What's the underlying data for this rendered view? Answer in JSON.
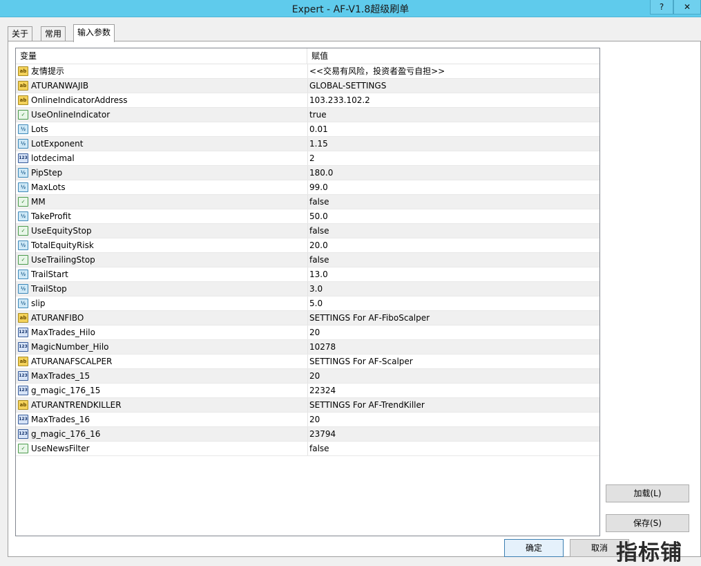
{
  "window": {
    "title": "Expert - AF-V1.8超级刷单",
    "help_label": "?",
    "close_label": "✕"
  },
  "tabs": [
    "关于",
    "常用",
    "输入参数"
  ],
  "active_tab": "输入参数",
  "table": {
    "columns": [
      "变量",
      "赋值"
    ],
    "rows": [
      {
        "type": "string",
        "name": "友情提示",
        "value": "<<交易有风险，投资者盈亏自担>>"
      },
      {
        "type": "string",
        "name": "ATURANWAJIB",
        "value": "GLOBAL-SETTINGS"
      },
      {
        "type": "string",
        "name": "OnlineIndicatorAddress",
        "value": "103.233.102.2"
      },
      {
        "type": "bool",
        "name": "UseOnlineIndicator",
        "value": "true"
      },
      {
        "type": "double",
        "name": "Lots",
        "value": "0.01"
      },
      {
        "type": "double",
        "name": "LotExponent",
        "value": "1.15"
      },
      {
        "type": "int",
        "name": "lotdecimal",
        "value": "2"
      },
      {
        "type": "double",
        "name": "PipStep",
        "value": "180.0"
      },
      {
        "type": "double",
        "name": "MaxLots",
        "value": "99.0"
      },
      {
        "type": "bool",
        "name": "MM",
        "value": "false"
      },
      {
        "type": "double",
        "name": "TakeProfit",
        "value": "50.0"
      },
      {
        "type": "bool",
        "name": "UseEquityStop",
        "value": "false"
      },
      {
        "type": "double",
        "name": "TotalEquityRisk",
        "value": "20.0"
      },
      {
        "type": "bool",
        "name": "UseTrailingStop",
        "value": "false"
      },
      {
        "type": "double",
        "name": "TrailStart",
        "value": "13.0"
      },
      {
        "type": "double",
        "name": "TrailStop",
        "value": "3.0"
      },
      {
        "type": "double",
        "name": "slip",
        "value": "5.0"
      },
      {
        "type": "string",
        "name": "ATURANFIBO",
        "value": "SETTINGS For AF-FiboScalper"
      },
      {
        "type": "int",
        "name": "MaxTrades_Hilo",
        "value": "20"
      },
      {
        "type": "int",
        "name": "MagicNumber_Hilo",
        "value": "10278"
      },
      {
        "type": "string",
        "name": "ATURANAFSCALPER",
        "value": "SETTINGS For AF-Scalper"
      },
      {
        "type": "int",
        "name": "MaxTrades_15",
        "value": "20"
      },
      {
        "type": "int",
        "name": "g_magic_176_15",
        "value": "22324"
      },
      {
        "type": "string",
        "name": "ATURANTRENDKILLER",
        "value": "SETTINGS For AF-TrendKiller"
      },
      {
        "type": "int",
        "name": "MaxTrades_16",
        "value": "20"
      },
      {
        "type": "int",
        "name": "g_magic_176_16",
        "value": "23794"
      },
      {
        "type": "bool",
        "name": "UseNewsFilter",
        "value": "false"
      }
    ]
  },
  "buttons": {
    "load": "加载(L)",
    "save": "保存(S)",
    "ok": "确定",
    "cancel": "取消"
  },
  "watermark": "指标铺",
  "icon_names": {
    "string": "string-type-icon",
    "double": "double-type-icon",
    "int": "integer-type-icon",
    "bool": "boolean-type-icon"
  }
}
